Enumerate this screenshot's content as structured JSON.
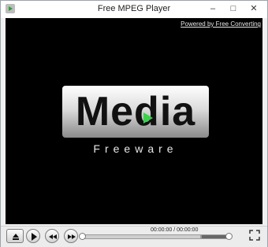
{
  "window": {
    "title": "Free MPEG Player"
  },
  "video": {
    "powered_by_link": "Powered by Free Converting",
    "logo_text": "Media",
    "logo_subtext": "Freeware"
  },
  "controls": {
    "time_display": "00:00:00 / 00:00:00",
    "seek_position": 0,
    "volume": 1.0,
    "icons": [
      "eject-icon",
      "play-icon",
      "previous-icon",
      "next-icon",
      "fullscreen-icon"
    ]
  },
  "colors": {
    "video_background": "#000000",
    "play_accent": "#39d34a"
  }
}
